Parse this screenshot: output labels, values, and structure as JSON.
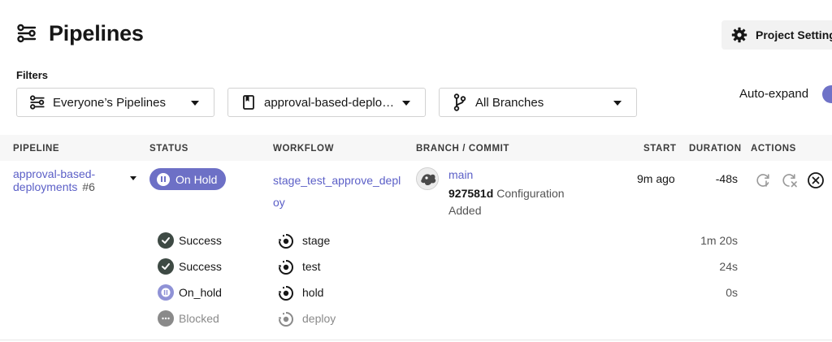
{
  "header": {
    "title": "Pipelines",
    "settings_label": "Project Settings"
  },
  "filters": {
    "label": "Filters",
    "pipelines_select": "Everyone’s Pipelines",
    "project_select": "approval-based-deplo…",
    "branches_select": "All Branches",
    "auto_expand_label": "Auto-expand",
    "auto_expand_on": true
  },
  "table": {
    "columns": [
      "PIPELINE",
      "STATUS",
      "WORKFLOW",
      "BRANCH / COMMIT",
      "START",
      "DURATION",
      "ACTIONS"
    ]
  },
  "pipeline": {
    "name": "approval-based-deployments",
    "number": "#6",
    "status": "On Hold",
    "workflow": "stage_test_approve_deploy",
    "branch": "main",
    "commit_sha": "927581d",
    "commit_message": "Configuration Added",
    "start": "9m ago",
    "duration": "-48s"
  },
  "jobs": [
    {
      "status": "Success",
      "name": "stage",
      "duration": "1m 20s"
    },
    {
      "status": "Success",
      "name": "test",
      "duration": "24s"
    },
    {
      "status": "On_hold",
      "name": "hold",
      "duration": "0s"
    },
    {
      "status": "Blocked",
      "name": "deploy",
      "duration": ""
    }
  ],
  "colors": {
    "accent": "#5b5fc7",
    "on_hold": "#6d70c6",
    "success": "#3e4a44",
    "blocked": "#8a8a8a"
  }
}
